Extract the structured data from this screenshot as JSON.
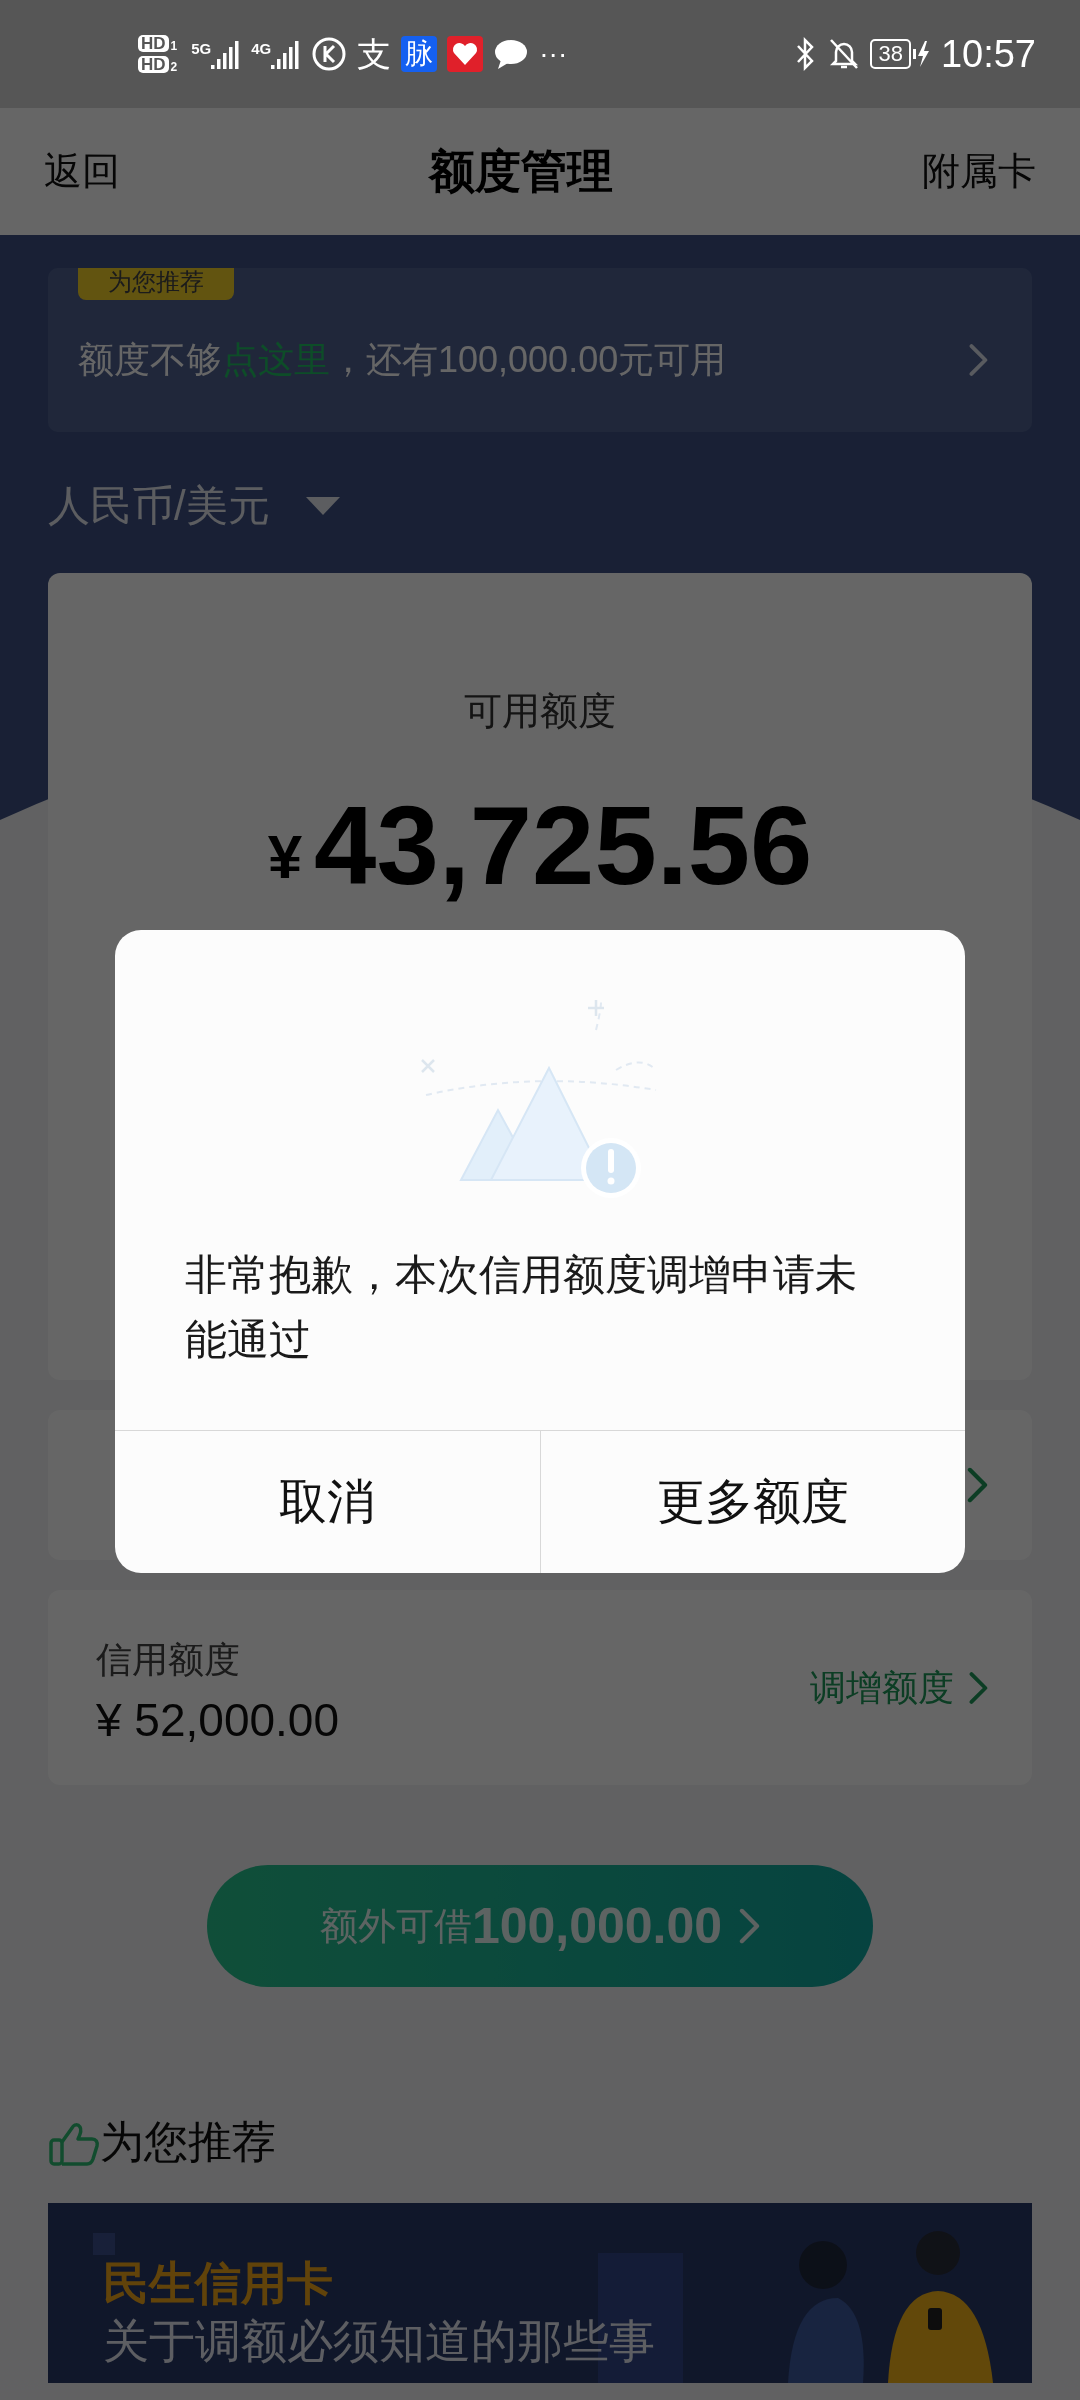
{
  "status_bar": {
    "sims": [
      {
        "label": "HD",
        "slot": "1"
      },
      {
        "label": "HD",
        "slot": "2"
      }
    ],
    "signals": [
      {
        "label": "5G"
      },
      {
        "label": "4G"
      }
    ],
    "apps": [
      {
        "kind": "k"
      },
      {
        "kind": "text",
        "text": "支"
      },
      {
        "kind": "badge",
        "text": "脉",
        "color": "#1560f0"
      },
      {
        "kind": "heart",
        "color": "#e0202a"
      },
      {
        "kind": "chat"
      }
    ],
    "more": "···",
    "battery": "38",
    "time": "10:57"
  },
  "header": {
    "back": "返回",
    "title": "额度管理",
    "action": "附属卡"
  },
  "promo": {
    "tag": "为您推荐",
    "text": "额度不够",
    "link": "点这里",
    "rest": "，还有100,000.00元可用"
  },
  "currency": {
    "label": "人民币/美元"
  },
  "available": {
    "label": "可用额度",
    "symbol": "¥",
    "amount": "43,725.56"
  },
  "credit": {
    "label": "信用额度",
    "amount": "¥ 52,000.00",
    "action": "调增额度"
  },
  "borrow_button": {
    "label": "额外可借",
    "amount": "100,000.00"
  },
  "recommend": {
    "title": "为您推荐",
    "banner": {
      "brand": "民生信用卡",
      "headline": "关于调额必须知道的那些事"
    }
  },
  "dialog": {
    "message": "非常抱歉，本次信用额度调增申请未能通过",
    "buttons": [
      "取消",
      "更多额度"
    ]
  }
}
